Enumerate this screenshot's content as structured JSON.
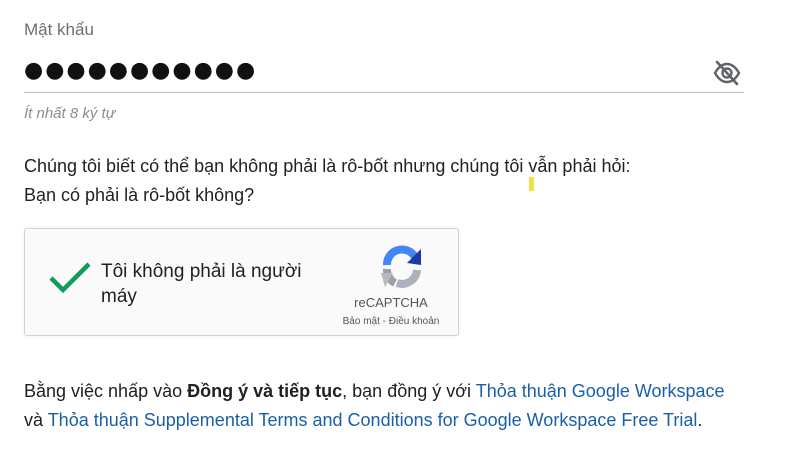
{
  "password": {
    "label": "Mật khẩu",
    "masked_value": "●●●●●●●●●●●",
    "hint": "Ít nhất 8 ký tự",
    "visibility_icon": "eye-off-icon"
  },
  "robot_check": {
    "question_line1": "Chúng tôi biết có thể bạn không phải là rô-bốt nhưng chúng tôi vẫn phải hỏi:",
    "question_line2": "Bạn có phải là rô-bốt không?"
  },
  "captcha": {
    "checked": true,
    "label": "Tôi không phải là người máy",
    "brand": "reCAPTCHA",
    "privacy_link": "Bảo mật",
    "separator": " - ",
    "terms_link": "Điều khoản",
    "check_color": "#0f9d58"
  },
  "agreement": {
    "prefix": "Bằng việc nhấp vào ",
    "button_ref": "Đồng ý và tiếp tục",
    "middle": ", bạn đồng ý với ",
    "link1": "Thỏa thuận Google Workspace",
    "line2_prefix": "và ",
    "link2": "Thỏa thuận Supplemental Terms and Conditions for Google Workspace Free Trial",
    "suffix": ".",
    "link_color": "#1a5fa8"
  }
}
